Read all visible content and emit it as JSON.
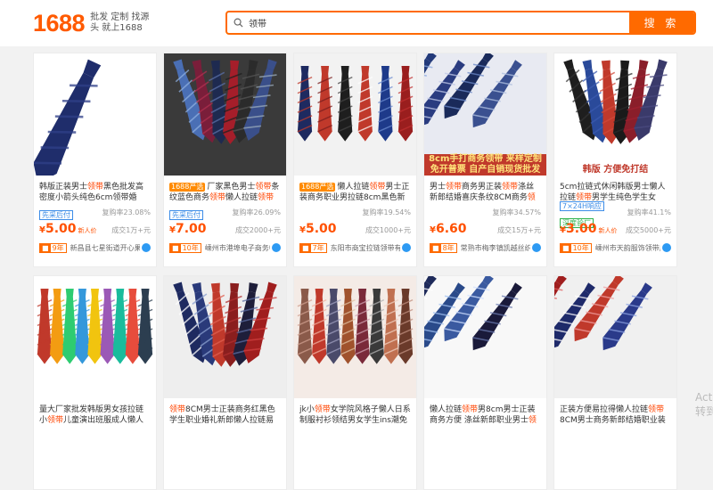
{
  "header": {
    "logo": "1688",
    "slogan": "批发 定制 找源头 就上1688",
    "search_value": "领带",
    "search_button": "搜 索"
  },
  "watermark": "Act 转到",
  "products": [
    {
      "title": [
        {
          "t": "韩版正装男士"
        },
        {
          "t": "领带",
          "kw": true
        },
        {
          "t": "黑色批发高密度小箭头纯色6cm领带婚"
        }
      ],
      "chips": [
        "先采后付"
      ],
      "rate": "复购率23.08%",
      "price": "5.00",
      "price_note": "新人价",
      "sold": "成交1万+元",
      "years": "9年",
      "shop": "新昌县七星街道开心果服饰",
      "img": {
        "bg": "#ffffff",
        "style": "single",
        "ties": [
          {
            "c": "#1f2d6b",
            "s": "#2f4089"
          }
        ],
        "overlay": ""
      }
    },
    {
      "tag": "1688严选",
      "title": [
        {
          "t": "厂家黑色男士"
        },
        {
          "t": "领带",
          "kw": true
        },
        {
          "t": "条纹蓝色商务"
        },
        {
          "t": "领带",
          "kw": true
        },
        {
          "t": "懒人拉链"
        },
        {
          "t": "领带",
          "kw": true
        },
        {
          "t": "现货批发"
        }
      ],
      "chips": [
        "先采后付"
      ],
      "rate": "复购率26.09%",
      "price": "7.00",
      "price_note": "",
      "sold": "成交2000+元",
      "years": "10年",
      "shop": "嵊州市港埠电子商务中心",
      "img": {
        "bg": "#3a3a3a",
        "style": "spread",
        "ties": [
          {
            "c": "#4a6fb5",
            "s": "#8fb0e0"
          },
          {
            "c": "#7a1e3a",
            "s": "#b03050"
          },
          {
            "c": "#1e2a50",
            "s": "#5a70a8"
          },
          {
            "c": "#a51e2a",
            "s": "#202020"
          },
          {
            "c": "#2b2b2b",
            "s": "#555"
          },
          {
            "c": "#3a4f8a",
            "s": "#9ab"
          }
        ],
        "overlay": ""
      }
    },
    {
      "tag": "1688严选",
      "title": [
        {
          "t": "懒人拉链"
        },
        {
          "t": "领带",
          "kw": true
        },
        {
          "t": "男士正装商务职业男拉链8cm黑色新郎结婚"
        }
      ],
      "chips": [],
      "rate": "复购率19.54%",
      "price": "5.00",
      "price_note": "",
      "sold": "成交1000+元",
      "years": "7年",
      "shop": "东阳市商宝拉链领带有限公司",
      "img": {
        "bg": "#f2f2f2",
        "style": "hang",
        "ties": [
          {
            "c": "#1e2a60",
            "s": "#c0392b"
          },
          {
            "c": "#c0392b",
            "s": "#7a1e1e"
          },
          {
            "c": "#1e1e1e",
            "s": "#444"
          },
          {
            "c": "#c0392b",
            "s": "#ffffff"
          },
          {
            "c": "#1e3a8a",
            "s": "#6a8ad0"
          },
          {
            "c": "#9a1e1e",
            "s": "#c03030"
          }
        ],
        "overlay": ""
      }
    },
    {
      "title": [
        {
          "t": "男士"
        },
        {
          "t": "领带",
          "kw": true
        },
        {
          "t": "商务男正装"
        },
        {
          "t": "领带",
          "kw": true
        },
        {
          "t": "涤丝新郎结婚喜庆条纹8CM商务"
        },
        {
          "t": "领带",
          "kw": true
        }
      ],
      "chips": [],
      "rate": "复购率34.57%",
      "price": "6.60",
      "price_note": "",
      "sold": "成交15万+元",
      "years": "8年",
      "shop": "常熟市梅李镇凯越丝织品厂",
      "img": {
        "bg": "#e8eaf2",
        "style": "diag",
        "ties": [
          {
            "c": "#233a7a",
            "s": "#8aa8e0"
          },
          {
            "c": "#2a3c80",
            "s": "#c0c8e8"
          },
          {
            "c": "#1a2a5a",
            "s": "#6a88c8"
          },
          {
            "c": "#3a5090",
            "s": "#b0c0e0"
          }
        ],
        "overlay": "8cm手打商务领带 来样定制 免开普票 自产自销现货批发",
        "ov_bg": "#c0392b",
        "ov_c": "#ffe27a"
      }
    },
    {
      "title": [
        {
          "t": "5cm拉链式休闲韩版男士懒人拉链"
        },
        {
          "t": "领带",
          "kw": true
        },
        {
          "t": "男学生纯色学生女"
        }
      ],
      "chips": [
        "7×24H响应",
        "深度验厂"
      ],
      "rate": "复购率41.1%",
      "price": "3.00",
      "price_note": "新人价",
      "sold": "成交5000+元",
      "years": "10年",
      "shop": "嵊州市天韵服饰领带厂",
      "img": {
        "bg": "#ffffff",
        "style": "spread",
        "ties": [
          {
            "c": "#1e1e1e",
            "s": "#333"
          },
          {
            "c": "#2a4a9a",
            "s": "#3a5ab0"
          },
          {
            "c": "#c0392b",
            "s": "#d04a3a"
          },
          {
            "c": "#1a1a1a",
            "s": "#2a2a2a"
          },
          {
            "c": "#8a1e2a",
            "s": "#a02030"
          },
          {
            "c": "#3a3a6a",
            "s": "#4a4a80"
          }
        ],
        "overlay": "韩版 方便免打结",
        "ov_bg": "rgba(255,255,255,0)",
        "ov_c": "#c0392b"
      }
    },
    {
      "title": [
        {
          "t": "量大厂家批发韩版男女孩拉链小"
        },
        {
          "t": "领带",
          "kw": true
        },
        {
          "t": "儿童演出班服成人懒人拉链"
        }
      ],
      "chips": [],
      "rate": "",
      "price": "",
      "price_note": "",
      "sold": "",
      "years": "",
      "shop": "",
      "img": {
        "bg": "#ffffff",
        "style": "hang",
        "ties": [
          {
            "c": "#c0392b",
            "s": "#c0392b"
          },
          {
            "c": "#f39c12",
            "s": "#f39c12"
          },
          {
            "c": "#2ecc71",
            "s": "#2ecc71"
          },
          {
            "c": "#3498db",
            "s": "#3498db"
          },
          {
            "c": "#f1c40f",
            "s": "#f1c40f"
          },
          {
            "c": "#9b59b6",
            "s": "#9b59b6"
          },
          {
            "c": "#1abc9c",
            "s": "#1abc9c"
          },
          {
            "c": "#e74c3c",
            "s": "#e74c3c"
          },
          {
            "c": "#2c3e50",
            "s": "#2c3e50"
          }
        ],
        "overlay": ""
      }
    },
    {
      "title": [
        {
          "t": "领带",
          "kw": true
        },
        {
          "t": "8CM男士正装商务红黑色学生职业婚礼新郎懒人拉链易拉拉带"
        }
      ],
      "chips": [],
      "rate": "",
      "price": "",
      "price_note": "",
      "sold": "",
      "years": "",
      "shop": "",
      "img": {
        "bg": "#eeeeee",
        "style": "spread",
        "ties": [
          {
            "c": "#1e2a60",
            "s": "#ffffff"
          },
          {
            "c": "#2a3a7a",
            "s": "#8aa0d0"
          },
          {
            "c": "#c0392b",
            "s": "#e06050"
          },
          {
            "c": "#8a1e1e",
            "s": "#b03030"
          },
          {
            "c": "#1e1e3a",
            "s": "#5a6aa0"
          },
          {
            "c": "#a01e1e",
            "s": "#d04040"
          }
        ],
        "overlay": ""
      }
    },
    {
      "title": [
        {
          "t": "jk小"
        },
        {
          "t": "领带",
          "kw": true
        },
        {
          "t": "女学院风格子懒人日系制服衬衫领结男女学生ins潮免打结"
        }
      ],
      "chips": [],
      "rate": "",
      "price": "",
      "price_note": "",
      "sold": "",
      "years": "",
      "shop": "",
      "img": {
        "bg": "#f4ebe6",
        "style": "hang",
        "ties": [
          {
            "c": "#8a5a4a",
            "s": "#d0a090"
          },
          {
            "c": "#c0392b",
            "s": "#f0b0a0"
          },
          {
            "c": "#4a4a6a",
            "s": "#a0a0c0"
          },
          {
            "c": "#a0522d",
            "s": "#e0c0a0"
          },
          {
            "c": "#7a2a3a",
            "s": "#d0a0b0"
          },
          {
            "c": "#3a3a3a",
            "s": "#b0b0b0"
          },
          {
            "c": "#c07050",
            "s": "#f0d0c0"
          },
          {
            "c": "#6a3a2a",
            "s": "#c09080"
          }
        ],
        "overlay": ""
      }
    },
    {
      "title": [
        {
          "t": "懒人拉链"
        },
        {
          "t": "领带",
          "kw": true
        },
        {
          "t": "男8cm男士正装商务方便 涤丝新郎职业男士"
        },
        {
          "t": "领带",
          "kw": true
        },
        {
          "t": "批发"
        }
      ],
      "chips": [],
      "rate": "",
      "price": "",
      "price_note": "",
      "sold": "",
      "years": "",
      "shop": "",
      "img": {
        "bg": "#f8f8f8",
        "style": "diag",
        "ties": [
          {
            "c": "#1e2a5a",
            "s": "#ffffff"
          },
          {
            "c": "#2a4a8a",
            "s": "#a0c0f0"
          },
          {
            "c": "#3a5aa0",
            "s": "#d0e0ff"
          },
          {
            "c": "#1a1a3a",
            "s": "#6a7ab0"
          }
        ],
        "overlay": ""
      }
    },
    {
      "title": [
        {
          "t": "正装方便易拉得懒人拉链"
        },
        {
          "t": "领带",
          "kw": true
        },
        {
          "t": " 8CM男士商务新郎结婚职业装领带"
        }
      ],
      "chips": [],
      "rate": "",
      "price": "",
      "price_note": "",
      "sold": "",
      "years": "",
      "shop": "",
      "img": {
        "bg": "#f0f0f0",
        "style": "diag",
        "ties": [
          {
            "c": "#a01e1e",
            "s": "#e06060"
          },
          {
            "c": "#1e2a6a",
            "s": "#ffffff"
          },
          {
            "c": "#c0392b",
            "s": "#f0a0a0"
          },
          {
            "c": "#2a3a8a",
            "s": "#8aa0e0"
          }
        ],
        "overlay": ""
      }
    }
  ]
}
